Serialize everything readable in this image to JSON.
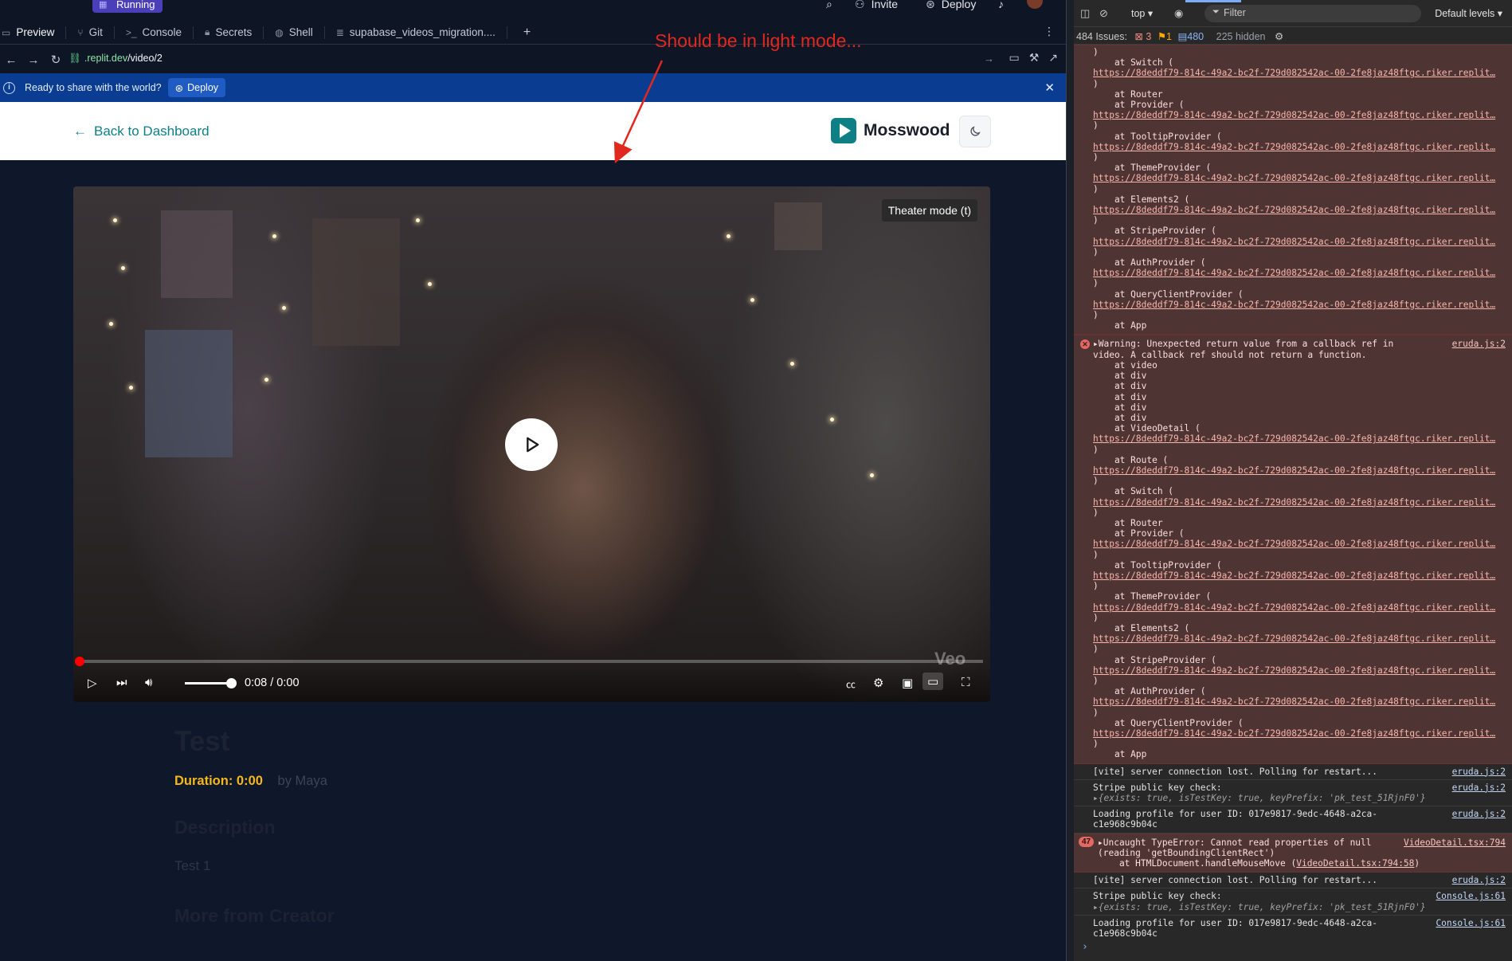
{
  "workspace": {
    "status": "Running",
    "invite_label": "Invite",
    "deploy_label": "Deploy",
    "tabs": [
      {
        "label": "Preview",
        "icon": "monitor-icon"
      },
      {
        "label": "Git",
        "icon": "git-branch-icon"
      },
      {
        "label": "Console",
        "icon": "terminal-icon"
      },
      {
        "label": "Secrets",
        "icon": "lock-icon"
      },
      {
        "label": "Shell",
        "icon": "shell-icon"
      },
      {
        "label": "supabase_videos_migration....",
        "icon": "database-icon"
      }
    ],
    "url_domain": ".replit.dev",
    "url_path": "/video/2",
    "banner": {
      "message": "Ready to share with the world?",
      "button": "Deploy"
    }
  },
  "app": {
    "back_label": "Back to Dashboard",
    "brand": "Mosswood",
    "video": {
      "theater_tooltip": "Theater mode (t)",
      "time": "0:08 / 0:00",
      "watermark": "Veo",
      "progress": 0.0,
      "volume": 0.9
    },
    "title": "Test",
    "duration": "Duration: 0:00",
    "author": "by Maya",
    "description_heading": "Description",
    "description": "Test 1",
    "more_heading": "More from Creator"
  },
  "annotation": {
    "text": "Should be in light mode...",
    "color": "#e0281e"
  },
  "devtools": {
    "context": "top ▾",
    "filter_placeholder": "Filter",
    "levels": "Default levels ▾",
    "issues": {
      "label": "484 Issues:",
      "errors": "3",
      "warnings": "1",
      "info": "480",
      "hidden": "225 hidden"
    },
    "link_url": "https://8deddf79-814c-49a2-bc2f-729d082542ac-00-2fe8jaz48ftgc.riker.replit…",
    "stack_top": [
      {
        "frame": "    at Switch (",
        "link": true
      },
      {
        "frame": "    at Router",
        "link": false
      },
      {
        "frame": "    at Provider (",
        "link": true
      },
      {
        "frame": "    at TooltipProvider (",
        "link": true
      },
      {
        "frame": "    at ThemeProvider (",
        "link": true
      },
      {
        "frame": "    at Elements2 (",
        "link": true
      },
      {
        "frame": "    at StripeProvider (",
        "link": true
      },
      {
        "frame": "    at AuthProvider (",
        "link": true
      },
      {
        "frame": "    at QueryClientProvider (",
        "link": true
      },
      {
        "frame": "    at App",
        "link": false
      }
    ],
    "warning": {
      "line1": "▸Warning: Unexpected return value from a callback ref in",
      "line2": "video. A callback ref should not return a function.",
      "source": "eruda.js:2",
      "frames": [
        {
          "frame": "    at video",
          "link": false
        },
        {
          "frame": "    at div",
          "link": false
        },
        {
          "frame": "    at div",
          "link": false
        },
        {
          "frame": "    at div",
          "link": false
        },
        {
          "frame": "    at div",
          "link": false
        },
        {
          "frame": "    at div",
          "link": false
        },
        {
          "frame": "    at VideoDetail (",
          "link": true
        },
        {
          "frame": "    at Route (",
          "link": true
        },
        {
          "frame": "    at Switch (",
          "link": true
        },
        {
          "frame": "    at Router",
          "link": false
        },
        {
          "frame": "    at Provider (",
          "link": true
        },
        {
          "frame": "    at TooltipProvider (",
          "link": true
        },
        {
          "frame": "    at ThemeProvider (",
          "link": true
        },
        {
          "frame": "    at Elements2 (",
          "link": true
        },
        {
          "frame": "    at StripeProvider (",
          "link": true
        },
        {
          "frame": "    at AuthProvider (",
          "link": true
        },
        {
          "frame": "    at QueryClientProvider (",
          "link": true
        },
        {
          "frame": "    at App",
          "link": false
        }
      ]
    },
    "vite1": {
      "text": "[vite] server connection lost. Polling for restart...",
      "source": "eruda.js:2"
    },
    "stripe1": {
      "text": "Stripe public key check:",
      "obj": "▸{exists: true, isTestKey: true, keyPrefix: 'pk_test_51RjnF0'}",
      "source": "eruda.js:2"
    },
    "profile1": {
      "line1": "Loading profile for user ID: 017e9817-9edc-4648-a2ca-",
      "line2": "c1e968c9b04c",
      "source": "eruda.js:2"
    },
    "typeerror": {
      "count": "47",
      "line1": "▸Uncaught TypeError: Cannot read properties of null",
      "line2": "(reading 'getBoundingClientRect')",
      "line3": "    at HTMLDocument.handleMouseMove (",
      "line3_link": "VideoDetail.tsx:794:58",
      "line3_end": ")",
      "source": "VideoDetail.tsx:794"
    },
    "vite2": {
      "text": "[vite] server connection lost. Polling for restart...",
      "source": "eruda.js:2"
    },
    "stripe2": {
      "text": "Stripe public key check:",
      "obj": "▸{exists: true, isTestKey: true, keyPrefix: 'pk_test_51RjnF0'}",
      "source": "Console.js:61"
    },
    "profile2": {
      "line1": "Loading profile for user ID: 017e9817-9edc-4648-a2ca-",
      "line2": "c1e968c9b04c",
      "source": "Console.js:61"
    }
  }
}
